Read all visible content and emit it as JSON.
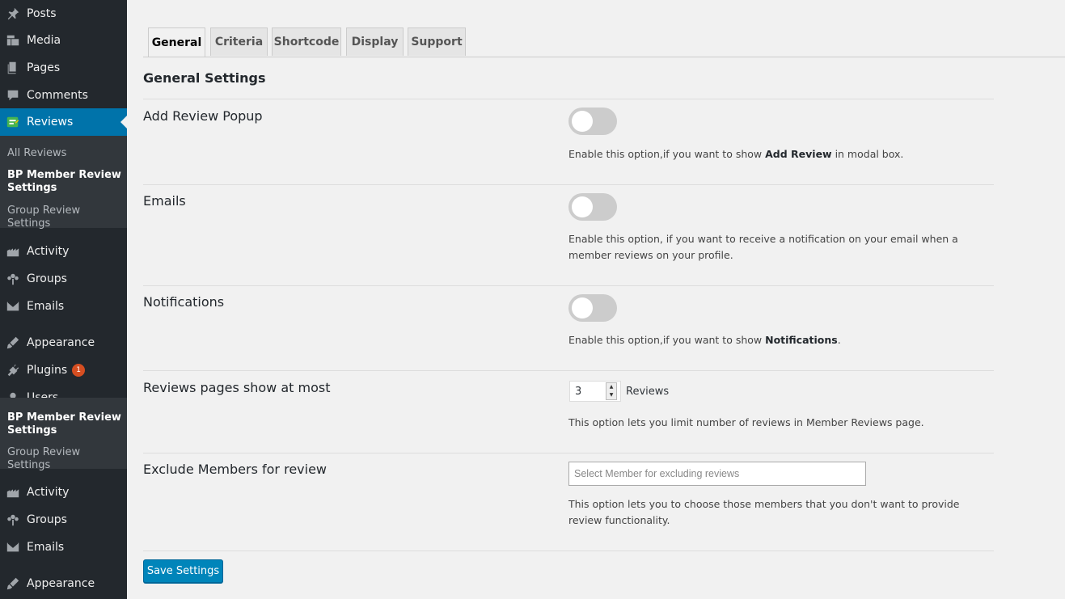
{
  "sidebar": {
    "top_items": [
      {
        "label": "Posts",
        "icon": "pin-icon"
      },
      {
        "label": "Media",
        "icon": "media-icon"
      },
      {
        "label": "Pages",
        "icon": "pages-icon"
      },
      {
        "label": "Comments",
        "icon": "comment-icon"
      },
      {
        "label": "Reviews",
        "icon": "reviews-icon"
      }
    ],
    "reviews_submenu": [
      "All Reviews",
      "BP Member Review Settings",
      "Group Review Settings"
    ],
    "mid_items": [
      {
        "label": "Activity",
        "icon": "activity-icon"
      },
      {
        "label": "Groups",
        "icon": "groups-icon"
      },
      {
        "label": "Emails",
        "icon": "mail-icon"
      },
      {
        "label": "Appearance",
        "icon": "brush-icon"
      },
      {
        "label": "Plugins",
        "icon": "plugin-icon",
        "badge": "1"
      },
      {
        "label": "Users",
        "icon": "user-icon"
      }
    ],
    "flyout_submenu": [
      "BP Member Review Settings",
      "Group Review Settings"
    ],
    "bottom_items": [
      {
        "label": "Activity",
        "icon": "activity-icon"
      },
      {
        "label": "Groups",
        "icon": "groups-icon"
      },
      {
        "label": "Emails",
        "icon": "mail-icon"
      },
      {
        "label": "Appearance",
        "icon": "brush-icon"
      }
    ]
  },
  "tabs": [
    "General",
    "Criteria",
    "Shortcode",
    "Display",
    "Support"
  ],
  "active_tab": "General",
  "section_title": "General Settings",
  "settings": {
    "add_review_popup": {
      "label": "Add Review Popup",
      "enabled": false,
      "desc_pre": "Enable this option,if you want to show ",
      "desc_bold": "Add Review",
      "desc_post": " in modal box."
    },
    "emails": {
      "label": "Emails",
      "enabled": false,
      "desc": "Enable this option, if you want to receive a notification on your email when a member reviews on your profile."
    },
    "notifications": {
      "label": "Notifications",
      "enabled": false,
      "desc_pre": "Enable this option,if you want to show ",
      "desc_bold": "Notifications",
      "desc_post": "."
    },
    "reviews_per_page": {
      "label": "Reviews pages show at most",
      "value": "3",
      "unit": "Reviews",
      "desc": "This option lets you limit number of reviews in Member Reviews page."
    },
    "exclude_members": {
      "label": "Exclude Members for review",
      "placeholder": "Select Member for excluding reviews",
      "desc": "This option lets you to choose those members that you don't want to provide review functionality."
    }
  },
  "save_label": "Save Settings",
  "colors": {
    "sidebar": "#23282d",
    "accent": "#0073aa",
    "button": "#0085ba",
    "badge": "#d54e21"
  }
}
